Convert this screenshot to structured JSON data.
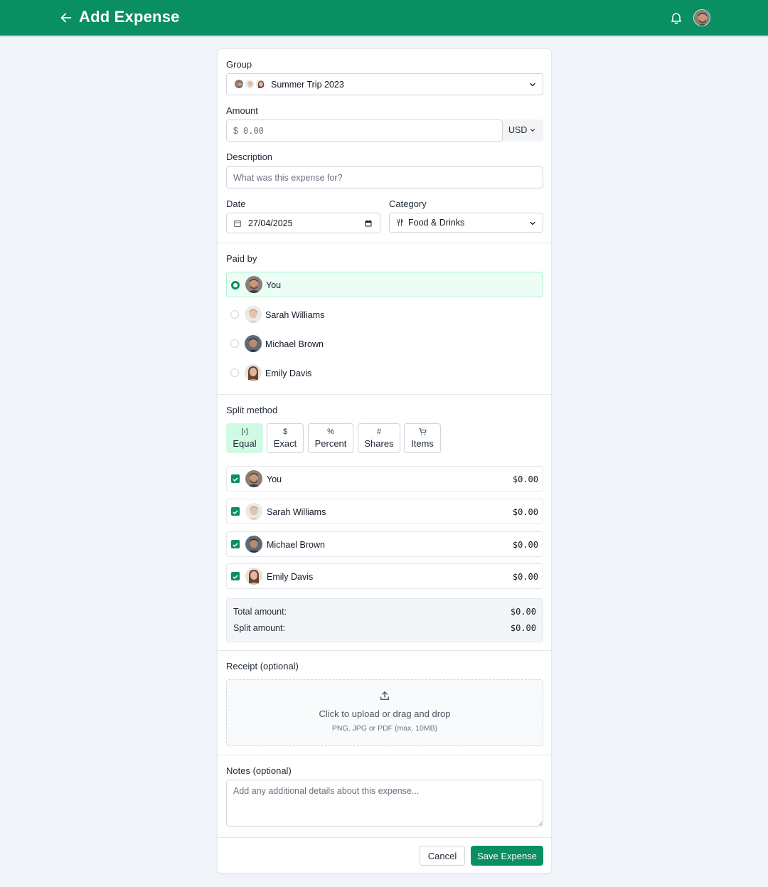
{
  "header": {
    "title": "Add Expense",
    "back_icon": "arrow-left-icon",
    "notification_icon": "bell-icon",
    "brand_color": "#0a8f63"
  },
  "form": {
    "group": {
      "label": "Group",
      "value": "Summer Trip 2023"
    },
    "amount": {
      "label": "Amount",
      "prefix": "$",
      "placeholder": "0.00",
      "currency": "USD"
    },
    "description": {
      "label": "Description",
      "placeholder": "What was this expense for?"
    },
    "date": {
      "label": "Date",
      "value": "27/04/2025"
    },
    "category": {
      "label": "Category",
      "value": "Food & Drinks",
      "icon": "utensils-icon"
    }
  },
  "paid_by": {
    "label": "Paid by",
    "selected_index": 0,
    "people": [
      {
        "name": "You"
      },
      {
        "name": "Sarah Williams"
      },
      {
        "name": "Michael Brown"
      },
      {
        "name": "Emily Davis"
      }
    ]
  },
  "split": {
    "label": "Split method",
    "active_index": 0,
    "methods": [
      {
        "symbol": "{}",
        "label": "Equal"
      },
      {
        "symbol": "$",
        "label": "Exact"
      },
      {
        "symbol": "%",
        "label": "Percent"
      },
      {
        "symbol": "#",
        "label": "Shares"
      },
      {
        "symbol": "cart",
        "label": "Items"
      }
    ],
    "members": [
      {
        "name": "You",
        "amount": "$0.00",
        "checked": true
      },
      {
        "name": "Sarah Williams",
        "amount": "$0.00",
        "checked": true
      },
      {
        "name": "Michael Brown",
        "amount": "$0.00",
        "checked": true
      },
      {
        "name": "Emily Davis",
        "amount": "$0.00",
        "checked": true
      }
    ],
    "total_label": "Total amount:",
    "total_value": "$0.00",
    "split_label": "Split amount:",
    "split_value": "$0.00"
  },
  "receipt": {
    "label": "Receipt (optional)",
    "primary_text": "Click to upload or drag and drop",
    "secondary_text": "PNG, JPG or PDF (max. 10MB)"
  },
  "notes": {
    "label": "Notes (optional)",
    "placeholder": "Add any additional details about this expense..."
  },
  "actions": {
    "cancel": "Cancel",
    "save": "Save Expense"
  }
}
